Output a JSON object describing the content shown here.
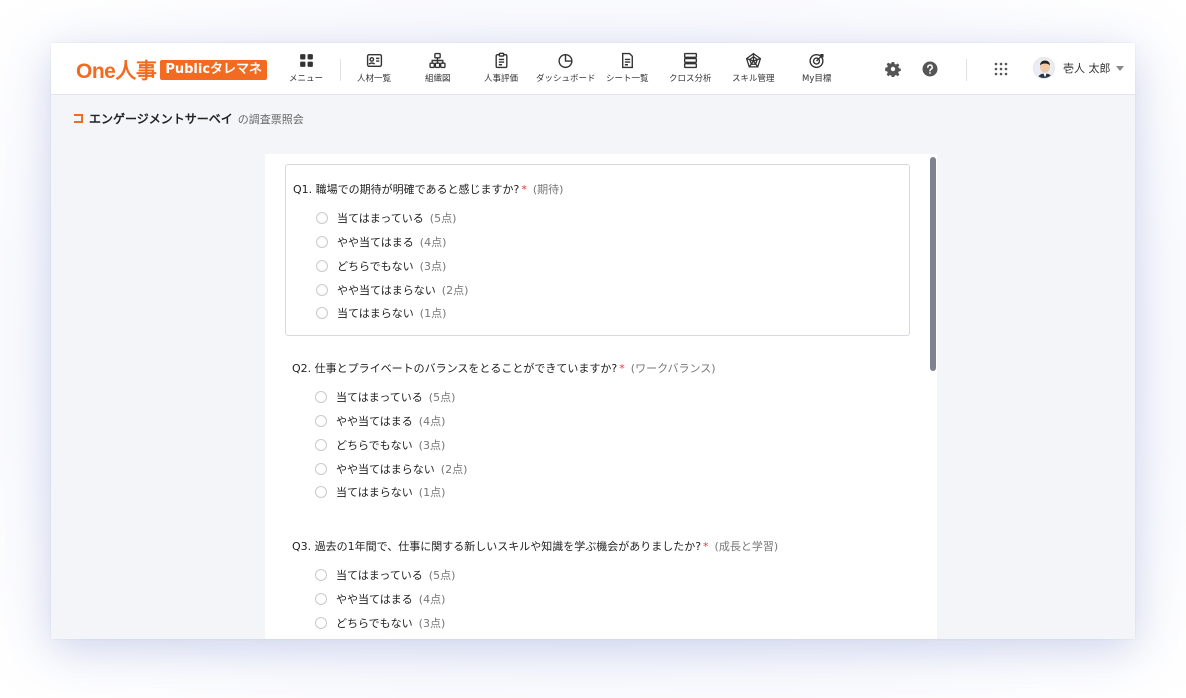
{
  "app": {
    "logo_main": "One人事",
    "logo_badge": "Publicタレマネ"
  },
  "nav": [
    {
      "label": "メニュー",
      "icon": "grid-menu-icon"
    },
    {
      "label": "人材一覧",
      "icon": "id-card-icon"
    },
    {
      "label": "組織図",
      "icon": "org-chart-icon"
    },
    {
      "label": "人事評価",
      "icon": "clipboard-icon"
    },
    {
      "label": "ダッシュボード",
      "icon": "pie-chart-icon"
    },
    {
      "label": "シート一覧",
      "icon": "document-icon"
    },
    {
      "label": "クロス分析",
      "icon": "layers-icon"
    },
    {
      "label": "スキル管理",
      "icon": "radar-chart-icon"
    },
    {
      "label": "My目標",
      "icon": "target-icon"
    }
  ],
  "header_right": {
    "settings_icon": "gear-icon",
    "help_icon": "help-icon",
    "apps_icon": "apps-grid-icon",
    "user_name": "壱人 太郎"
  },
  "breadcrumb": {
    "title": "エンゲージメントサーベイ",
    "subtitle": "の調査票照会"
  },
  "questions": [
    {
      "title": "Q1. 職場での期待が明確であると感じますか?",
      "required": "*",
      "category": "(期待)",
      "options": [
        {
          "label": "当てはまっている",
          "points": "(5点)"
        },
        {
          "label": "やや当てはまる",
          "points": "(4点)"
        },
        {
          "label": "どちらでもない",
          "points": "(3点)"
        },
        {
          "label": "やや当てはまらない",
          "points": "(2点)"
        },
        {
          "label": "当てはまらない",
          "points": "(1点)"
        }
      ]
    },
    {
      "title": "Q2. 仕事とプライベートのバランスをとることができていますか?",
      "required": "*",
      "category": "(ワークバランス)",
      "options": [
        {
          "label": "当てはまっている",
          "points": "(5点)"
        },
        {
          "label": "やや当てはまる",
          "points": "(4点)"
        },
        {
          "label": "どちらでもない",
          "points": "(3点)"
        },
        {
          "label": "やや当てはまらない",
          "points": "(2点)"
        },
        {
          "label": "当てはまらない",
          "points": "(1点)"
        }
      ]
    },
    {
      "title": "Q3. 過去の1年間で、仕事に関する新しいスキルや知識を学ぶ機会がありましたか?",
      "required": "*",
      "category": "(成長と学習)",
      "options": [
        {
          "label": "当てはまっている",
          "points": "(5点)"
        },
        {
          "label": "やや当てはまる",
          "points": "(4点)"
        },
        {
          "label": "どちらでもない",
          "points": "(3点)"
        }
      ]
    }
  ],
  "colors": {
    "brand": "#f26b21",
    "required": "#e53935"
  }
}
